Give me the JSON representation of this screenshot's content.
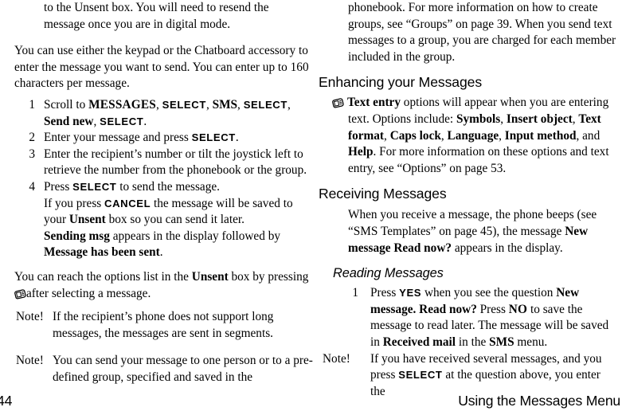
{
  "page": {
    "number": "44",
    "running_header": "Using the Messages Menu"
  },
  "icons": {
    "menu_key": "menu-key-icon"
  },
  "left_column": {
    "continued_paragraph": {
      "line1": "to the Unsent box. You will need to resend the",
      "line2": "message once you are in digital mode."
    },
    "intro_paragraph": "You can use either the keypad or the Chatboard accessory to enter the message you want to send. You can enter up to 160 characters per message.",
    "steps": [
      {
        "num": "1",
        "pre": "Scroll to ",
        "menu1": "MESSAGES",
        "sep1": ", ",
        "key1": "SELECT",
        "sep2": ", ",
        "item2": "SMS",
        "sep3": ", ",
        "key2": "SELECT",
        "sep4": ", ",
        "item3": "Send new",
        "sep5": ", ",
        "key3": "SELECT",
        "end": "."
      },
      {
        "num": "2",
        "pre": "Enter your message and press ",
        "key1": "SELECT",
        "end": "."
      },
      {
        "num": "3",
        "pre": "Enter the recipient’s number or tilt the joystick left to retrieve the number from the phonebook or the group.",
        "end": ""
      },
      {
        "num": "4",
        "pre": "Press ",
        "key1": "SELECT",
        "end": " to send the message."
      }
    ],
    "step4_sub": {
      "part1": "If you press ",
      "cancel_key": "CANCEL",
      "part2": " the message will be saved to your ",
      "unsent": "Unsent",
      "part3": " box so you can send it later.",
      "sending": "Sending msg",
      "part4": " appears in the display followed by ",
      "sent": "Message has been sent",
      "part5": "."
    },
    "options_paragraph": {
      "part1": "You can reach the options list in the ",
      "unsent": "Unsent",
      "part2": " box by pressing ",
      "part3": "after selecting a message."
    },
    "notes": [
      {
        "label": "Note!",
        "text": "If the recipient’s phone does not support long messages, the messages are sent in segments."
      },
      {
        "label": "Note!",
        "text": "You can send your message to one person or to a pre-defined group, specified and saved in the"
      }
    ]
  },
  "right_column": {
    "continued_paragraph": "phonebook. For more information on how to create groups, see “Groups” on page 39. When you send text messages to a group, you are charged for each member included in the group.",
    "heading_enhancing": "Enhancing your Messages",
    "text_entry_paragraph": {
      "bold_lead": "Text entry",
      "part1": " options will appear when you are entering text. Options include: ",
      "opt1": "Symbols",
      "sep1": ", ",
      "opt2": "Insert object",
      "sep2": ", ",
      "opt3": "Text format",
      "sep3": ", ",
      "opt4": "Caps lock",
      "sep4": ", ",
      "opt5": "Language",
      "sep5": ", ",
      "opt6": "Input method",
      "sep6": ", and ",
      "opt7": "Help",
      "part2": ". For more information on these options and text entry, see “Options” on page 53."
    },
    "heading_receiving": "Receiving Messages",
    "receiving_paragraph": {
      "part1": "When you receive a message, the phone beeps (see “SMS Templates” on page 45), the message ",
      "bold1": "New message Read now?",
      "part2": " appears in the display."
    },
    "heading_reading": "Reading Messages",
    "steps": [
      {
        "num": "1",
        "pre": "Press ",
        "key1": "YES",
        "mid1": " when you see the question ",
        "bold1": "New message. Read now?",
        "mid2": " Press ",
        "key2": "NO",
        "mid3": " to save the message to read later. The message will be saved in ",
        "bold2": "Received mail",
        "mid4": " in the ",
        "bold3": "SMS",
        "end": " menu."
      }
    ],
    "notes": [
      {
        "label": "Note!",
        "part1": "If you have received several messages, and you press ",
        "key1": "SELECT",
        "part2": " at the question above, you enter the"
      }
    ]
  }
}
